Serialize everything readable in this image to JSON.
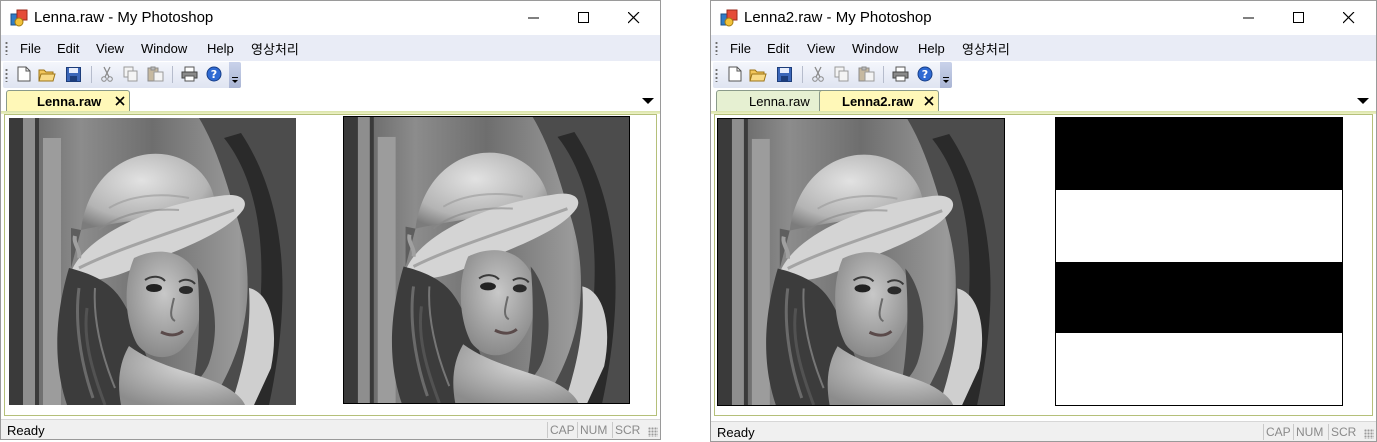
{
  "window1": {
    "title": "Lenna.raw - My Photoshop",
    "menus": [
      "File",
      "Edit",
      "View",
      "Window",
      "Help",
      "영상처리"
    ],
    "tabs": [
      {
        "label": "Lenna.raw",
        "active": true
      }
    ],
    "views": [
      {
        "kind": "lenna-photo"
      },
      {
        "kind": "lenna-photo"
      }
    ],
    "status": {
      "text": "Ready",
      "indicators": [
        "CAP",
        "NUM",
        "SCR"
      ]
    }
  },
  "window2": {
    "title": "Lenna2.raw - My Photoshop",
    "menus": [
      "File",
      "Edit",
      "View",
      "Window",
      "Help",
      "영상처리"
    ],
    "tabs": [
      {
        "label": "Lenna.raw",
        "active": false
      },
      {
        "label": "Lenna2.raw",
        "active": true
      }
    ],
    "views": [
      {
        "kind": "lenna-photo"
      },
      {
        "kind": "horizontal-stripes",
        "stripes": [
          "#000000",
          "#ffffff",
          "#000000",
          "#ffffff"
        ]
      }
    ],
    "status": {
      "text": "Ready",
      "indicators": [
        "CAP",
        "NUM",
        "SCR"
      ]
    }
  },
  "toolbar_icons": [
    "new-file-icon",
    "open-folder-icon",
    "save-icon",
    "cut-icon",
    "copy-icon",
    "paste-icon",
    "print-icon",
    "help-icon"
  ],
  "colors": {
    "menubar": "#e9ecf6",
    "tab_active": "#fff8b8",
    "tab_inactive": "#e6f0d2",
    "statusbar": "#f0f0f0"
  }
}
